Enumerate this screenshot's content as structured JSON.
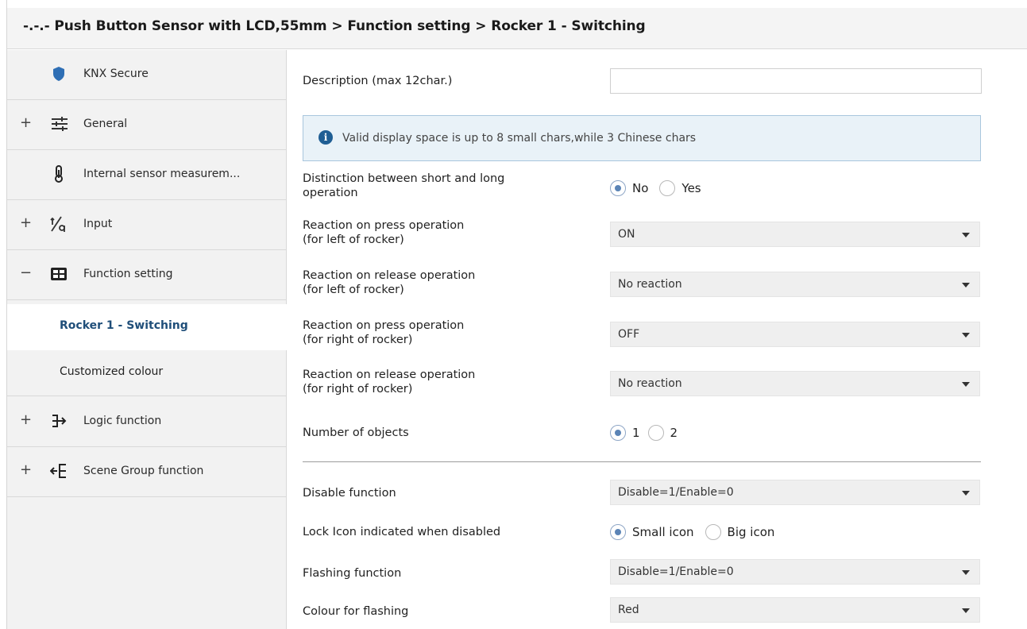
{
  "breadcrumb": "-.-.- Push Button Sensor with LCD,55mm > Function setting > Rocker 1 - Switching",
  "sidebar": {
    "items": [
      {
        "label": "KNX Secure",
        "expander": ""
      },
      {
        "label": "General",
        "expander": "+"
      },
      {
        "label": "Internal sensor measurem...",
        "expander": ""
      },
      {
        "label": "Input",
        "expander": "+"
      },
      {
        "label": "Function setting",
        "expander": "−"
      },
      {
        "label": "Logic function",
        "expander": "+"
      },
      {
        "label": "Scene Group function",
        "expander": "+"
      }
    ],
    "subitems": [
      {
        "label": "Rocker 1 - Switching"
      },
      {
        "label": "Customized colour"
      }
    ]
  },
  "main": {
    "description": {
      "label": "Description (max 12char.)",
      "value": ""
    },
    "info_text": "Valid display space is up to 8 small chars,while 3 Chinese chars",
    "distinction": {
      "label1": "Distinction between short and long",
      "label2": "operation",
      "options": [
        "No",
        "Yes"
      ],
      "selected": "No"
    },
    "press_left": {
      "label1": "Reaction on press operation",
      "label2": "(for left of rocker)",
      "value": "ON"
    },
    "release_left": {
      "label1": "Reaction on release operation",
      "label2": "(for left of rocker)",
      "value": "No reaction"
    },
    "press_right": {
      "label1": "Reaction on press operation",
      "label2": "(for right of rocker)",
      "value": "OFF"
    },
    "release_right": {
      "label1": "Reaction on release operation",
      "label2": "(for right of rocker)",
      "value": "No reaction"
    },
    "num_objects": {
      "label": "Number of objects",
      "options": [
        "1",
        "2"
      ],
      "selected": "1"
    },
    "disable_function": {
      "label": "Disable function",
      "value": "Disable=1/Enable=0"
    },
    "lock_icon": {
      "label": "Lock Icon indicated when disabled",
      "options": [
        "Small icon",
        "Big icon"
      ],
      "selected": "Small icon"
    },
    "flashing_function": {
      "label": "Flashing function",
      "value": "Disable=1/Enable=0"
    },
    "colour_flashing": {
      "label": "Colour for flashing",
      "value": "Red"
    }
  },
  "colors": {
    "accent": "#1f4e79",
    "shield": "#2f6fb5",
    "info_bg": "#e9f2f8",
    "info_icon": "#1f5e94"
  }
}
